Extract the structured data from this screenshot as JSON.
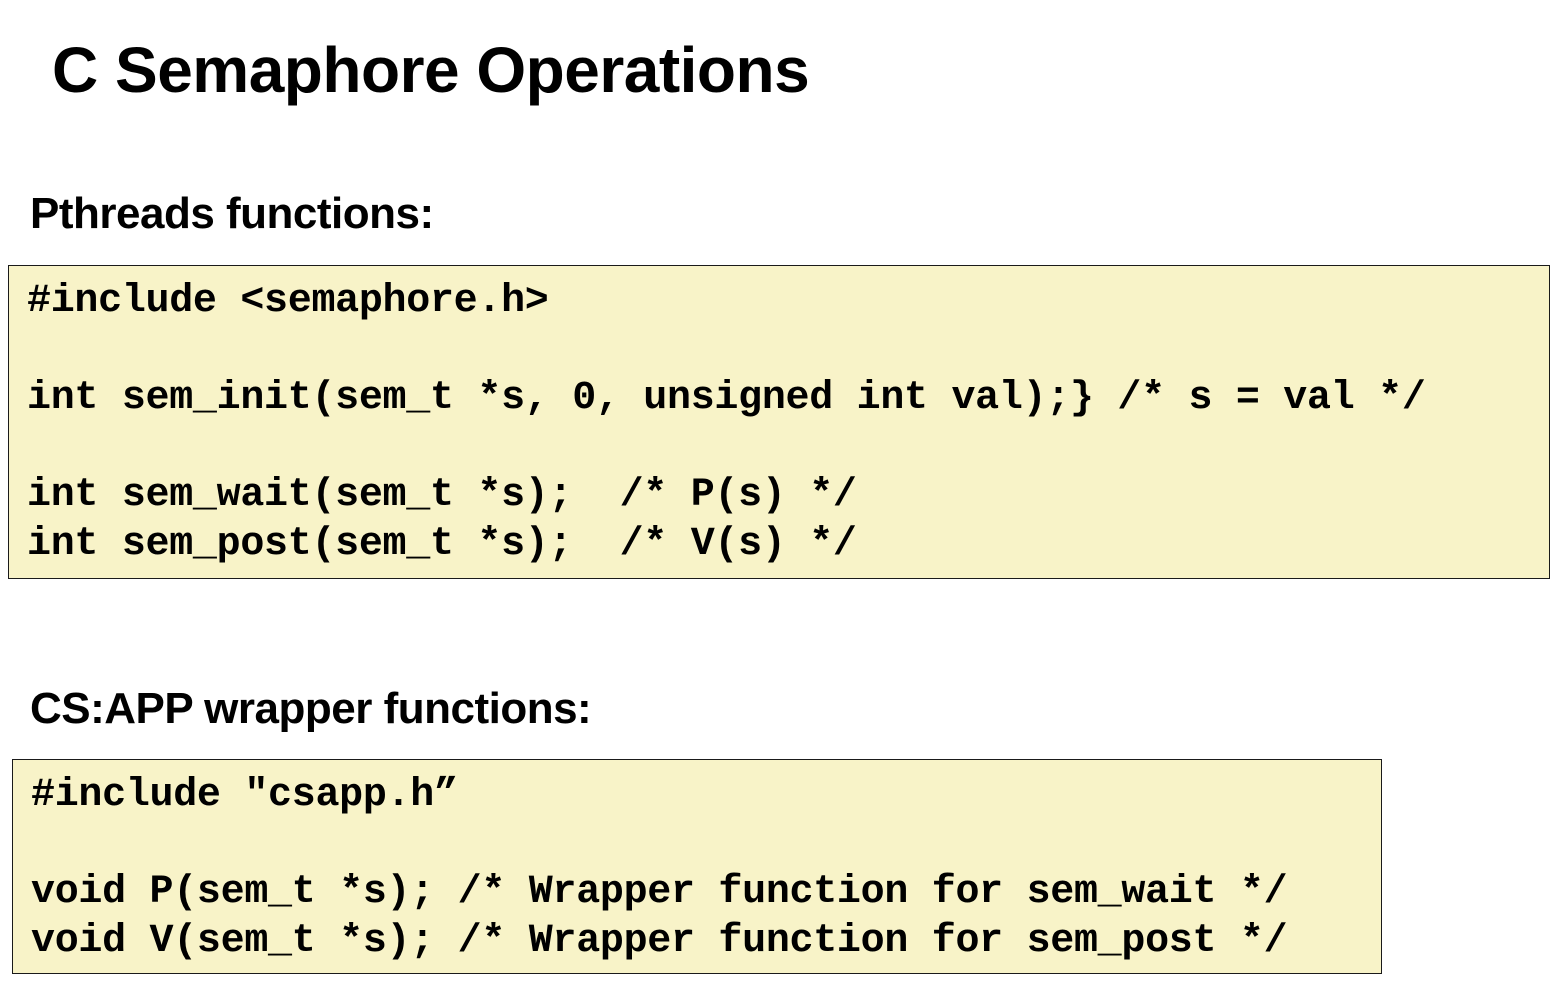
{
  "title": "C Semaphore Operations",
  "pthreads": {
    "heading": "Pthreads functions:",
    "lines": [
      "#include <semaphore.h>",
      "",
      "int sem_init(sem_t *s, 0, unsigned int val);} /* s = val */",
      "",
      "int sem_wait(sem_t *s);  /* P(s) */",
      "int sem_post(sem_t *s);  /* V(s) */"
    ]
  },
  "csapp": {
    "heading": "CS:APP wrapper functions:",
    "lines": [
      "#include \"csapp.h”",
      "",
      "void P(sem_t *s); /* Wrapper function for sem_wait */",
      "void V(sem_t *s); /* Wrapper function for sem_post */"
    ]
  }
}
